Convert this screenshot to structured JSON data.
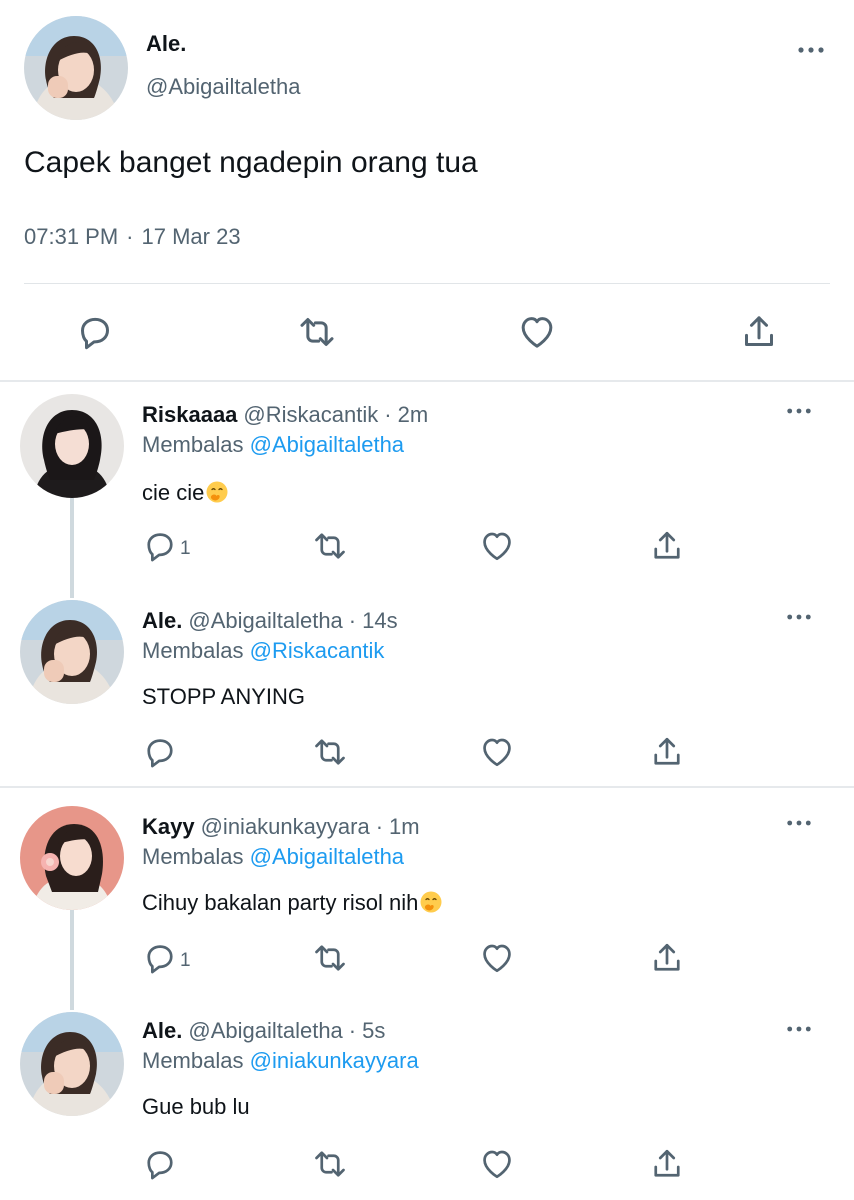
{
  "main_tweet": {
    "name": "Ale.",
    "handle": "@Abigailtaletha",
    "text": "Capek banget ngadepin orang tua",
    "time": "07:31 PM",
    "separator": "·",
    "date": "17 Mar 23",
    "actions": [
      {
        "icon": "reply-icon"
      },
      {
        "icon": "retweet-icon"
      },
      {
        "icon": "like-icon"
      },
      {
        "icon": "share-icon"
      }
    ]
  },
  "replies": [
    {
      "name": "Riskaaaa",
      "handle": "@Riskacantik",
      "separator": "·",
      "time": "2m",
      "replying_label": "Membalas",
      "replying_to": "@Abigailtaletha",
      "text": "cie cie",
      "emoji": "face-with-hand-over-mouth",
      "reply_count": "1",
      "avatar": "avatar-dark-hair"
    },
    {
      "name": "Ale.",
      "handle": "@Abigailtaletha",
      "separator": "·",
      "time": "14s",
      "replying_label": "Membalas",
      "replying_to": "@Riskacantik",
      "text": "STOPP ANYING",
      "reply_count": "",
      "avatar": "avatar-ale"
    },
    {
      "name": "Kayy",
      "handle": "@iniakunkayyara",
      "separator": "·",
      "time": "1m",
      "replying_label": "Membalas",
      "replying_to": "@Abigailtaletha",
      "text": "Cihuy bakalan party risol nih",
      "emoji": "face-with-hand-over-mouth",
      "reply_count": "1",
      "avatar": "avatar-flower"
    },
    {
      "name": "Ale.",
      "handle": "@Abigailtaletha",
      "separator": "·",
      "time": "5s",
      "replying_label": "Membalas",
      "replying_to": "@iniakunkayyara",
      "text": "Gue bub lu",
      "reply_count": "",
      "avatar": "avatar-ale"
    }
  ],
  "colors": {
    "text": "#0f1419",
    "secondary": "#536471",
    "link": "#1d9bf0",
    "divider": "#e6e9ec",
    "thread_line": "#cfd9de"
  }
}
